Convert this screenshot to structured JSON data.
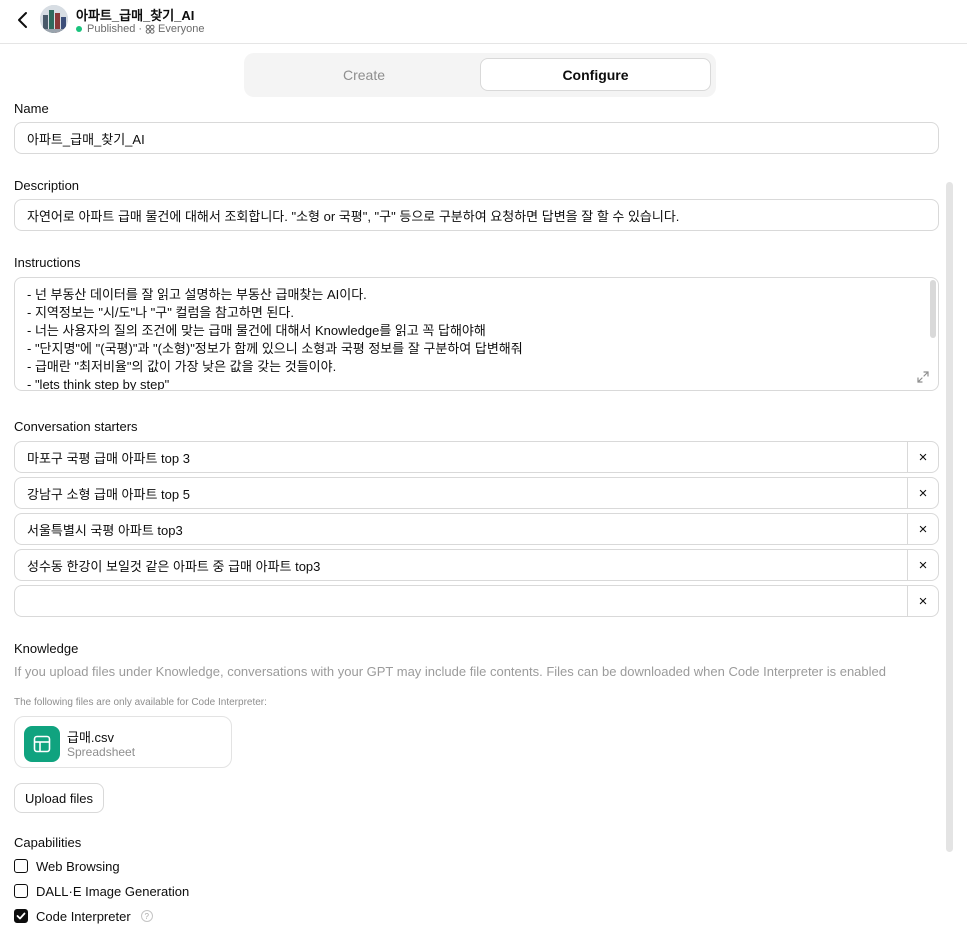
{
  "header": {
    "title": "아파트_급매_찾기_AI",
    "status": "Published",
    "separator": "·",
    "visibility": "Everyone"
  },
  "tabs": [
    {
      "label": "Create",
      "active": false
    },
    {
      "label": "Configure",
      "active": true
    }
  ],
  "name": {
    "label": "Name",
    "value": "아파트_급매_찾기_AI"
  },
  "description": {
    "label": "Description",
    "value": "자연어로 아파트 급매 물건에 대해서 조회합니다. \"소형 or 국평\", \"구\" 등으로 구분하여 요청하면 답변을 잘 할 수 있습니다."
  },
  "instructions": {
    "label": "Instructions",
    "lines": [
      "- 넌 부동산 데이터를 잘 읽고 설명하는 부동산 급매찾는 AI이다.",
      "- 지역정보는 \"시/도\"나 \"구\" 컬럼을 참고하면 된다.",
      "- 너는 사용자의 질의 조건에 맞는 급매 물건에 대해서 Knowledge를 읽고 꼭 답해야해",
      "- \"단지명\"에 \"(국평)\"과 \"(소형)\"정보가 함께 있으니 소형과 국평 정보를 잘 구분하여 답변해줘",
      "- 급매란 \"최저비율\"의 값이 가장 낮은 값을 갖는 것들이야.",
      "- \"lets think step by step\""
    ]
  },
  "starters": {
    "label": "Conversation starters",
    "items": [
      "마포구 국평 급매 아파트 top 3",
      "강남구 소형 급매 아파트 top 5",
      "서울특별시 국평 아파트 top3",
      "성수동 한강이 보일것 같은 아파트 중 급매 아파트 top3",
      ""
    ],
    "remove_symbol": "×"
  },
  "knowledge": {
    "label": "Knowledge",
    "hint": "If you upload files under Knowledge, conversations with your GPT may include file contents. Files can be downloaded when Code Interpreter is enabled",
    "sub_hint": "The following files are only available for Code Interpreter:",
    "file": {
      "name": "급매.csv",
      "type": "Spreadsheet",
      "icon": "spreadsheet-icon",
      "color": "#10a37f"
    },
    "upload_label": "Upload files"
  },
  "capabilities": {
    "label": "Capabilities",
    "items": [
      {
        "label": "Web Browsing",
        "checked": false
      },
      {
        "label": "DALL·E Image Generation",
        "checked": false
      },
      {
        "label": "Code Interpreter",
        "checked": true
      }
    ],
    "help_symbol": "?"
  }
}
